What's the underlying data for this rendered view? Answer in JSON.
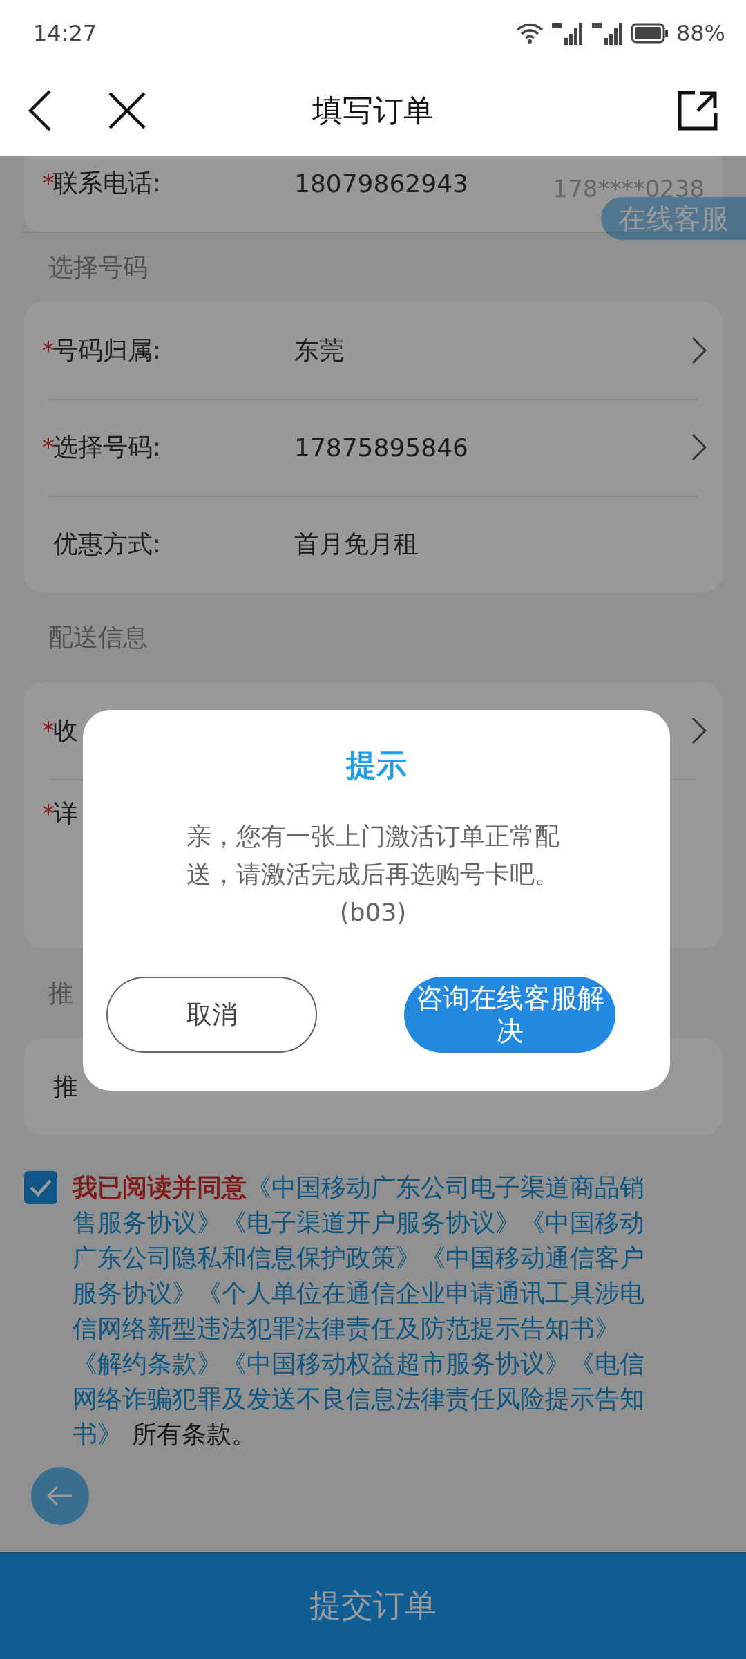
{
  "status_bar": {
    "time": "14:27",
    "battery": "88%"
  },
  "nav": {
    "title": "填写订单"
  },
  "contact": {
    "label": "联系电话:",
    "required_mark": "*",
    "value": "18079862943",
    "masked": "178****0238",
    "service_button": "在线客服"
  },
  "sections": [
    {
      "title": "选择号码",
      "rows": [
        {
          "label": "号码归属:",
          "required_mark": "*",
          "value": "东莞",
          "has_arrow": true
        },
        {
          "label": "选择号码:",
          "required_mark": "*",
          "value": "17875895846",
          "has_arrow": true
        },
        {
          "label": "优惠方式:",
          "value": "首月免月租",
          "has_arrow": false
        }
      ]
    },
    {
      "title": "配送信息",
      "rows": [
        {
          "label": "收",
          "required_mark": "*",
          "has_arrow": true,
          "kind": "short"
        },
        {
          "label": "详",
          "required_mark": "*",
          "has_arrow": false,
          "kind": "tall"
        }
      ]
    },
    {
      "title": "推",
      "rows": [
        {
          "label": "推",
          "has_arrow": false,
          "kind": "short"
        }
      ]
    }
  ],
  "agreement": {
    "checked": true,
    "parts": [
      {
        "kind": "lead",
        "text": "我已阅读并同意"
      },
      {
        "kind": "link",
        "text": "《中国移动广东公司电子渠道商品销售服务协议》"
      },
      {
        "kind": "link",
        "text": "《电子渠道开户服务协议》"
      },
      {
        "kind": "link",
        "text": "《中国移动广东公司隐私和信息保护政策》"
      },
      {
        "kind": "link",
        "text": "《中国移动通信客户服务协议》"
      },
      {
        "kind": "link",
        "text": "《个人单位在通信企业申请通讯工具涉电信网络新型违法犯罪法律责任及防范提示告知书》"
      },
      {
        "kind": "link",
        "text": "《解约条款》"
      },
      {
        "kind": "link",
        "text": "《中国移动权益超市服务协议》"
      },
      {
        "kind": "link",
        "text": "《电信网络诈骗犯罪及发送不良信息法律责任风险提示告知书》"
      },
      {
        "kind": "plain",
        "text": "所有条款。"
      }
    ]
  },
  "submit_button": "提交订单",
  "dialog": {
    "title": "提示",
    "message": "亲，您有一张上门激活订单正常配送，请激活完成后再选购号卡吧。(b03)",
    "cancel": "取消",
    "confirm": "咨询在线客服解决"
  }
}
